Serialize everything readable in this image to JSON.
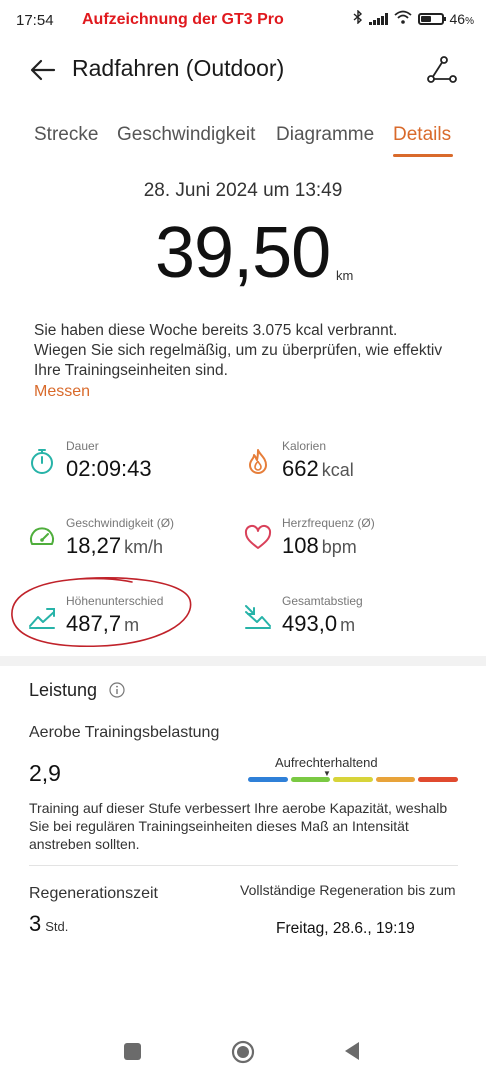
{
  "status_bar": {
    "time": "17:54",
    "caption": "Aufzeichnung der GT3 Pro",
    "battery": "46",
    "battery_unit": "%"
  },
  "header": {
    "title": "Radfahren (Outdoor)",
    "icons": [
      "back-arrow-icon",
      "route-icon"
    ]
  },
  "tabs": [
    {
      "label": "Strecke",
      "active": false
    },
    {
      "label": "Geschwindigkeit",
      "active": false
    },
    {
      "label": "Diagramme",
      "active": false
    },
    {
      "label": "Details",
      "active": true
    }
  ],
  "summary": {
    "date": "28. Juni 2024 um 13:49",
    "distance": "39,50",
    "distance_unit": "km",
    "info_text": "Sie haben diese Woche bereits 3.075 kcal verbrannt. Wiegen Sie sich regelmäßig, um zu überprüfen, wie effektiv Ihre Trainingseinheiten sind.",
    "measure_link": "Messen"
  },
  "metrics": {
    "duration": {
      "label": "Dauer",
      "value": "02:09:43",
      "unit": "",
      "icon": "stopwatch-icon"
    },
    "calories": {
      "label": "Kalorien",
      "value": "662",
      "unit": "kcal",
      "icon": "flame-icon"
    },
    "speed": {
      "label": "Geschwindigkeit (Ø)",
      "value": "18,27",
      "unit": "km/h",
      "icon": "speedometer-icon"
    },
    "heart_rate": {
      "label": "Herzfrequenz (Ø)",
      "value": "108",
      "unit": "bpm",
      "icon": "heart-icon"
    },
    "elevation_gain": {
      "label": "Höhenunterschied",
      "value": "487,7",
      "unit": "m",
      "icon": "ascent-icon"
    },
    "total_descent": {
      "label": "Gesamtabstieg",
      "value": "493,0",
      "unit": "m",
      "icon": "descent-icon"
    }
  },
  "performance": {
    "title": "Leistung",
    "aerobic_label": "Aerobe Trainingsbelastung",
    "aerobic_value": "2,9",
    "status_label": "Aufrechterhaltend",
    "scale_colors": [
      "#2f80d8",
      "#7ac943",
      "#d7d43a",
      "#e8a33a",
      "#e04a2f"
    ],
    "description": "Training auf dieser Stufe verbessert Ihre aerobe Kapazität, weshalb Sie bei regulären Trainingseinheiten dieses Maß an Intensität anstreben sollten.",
    "regen_label": "Regenerationszeit",
    "regen_value": "3",
    "regen_unit": "Std.",
    "full_regen_label": "Vollständige Regeneration bis zum",
    "full_regen_value": "Freitag, 28.6., 19:19"
  },
  "colors": {
    "accent": "#d96a2b",
    "teal": "#27b3a8",
    "annotation": "#c0222a"
  }
}
